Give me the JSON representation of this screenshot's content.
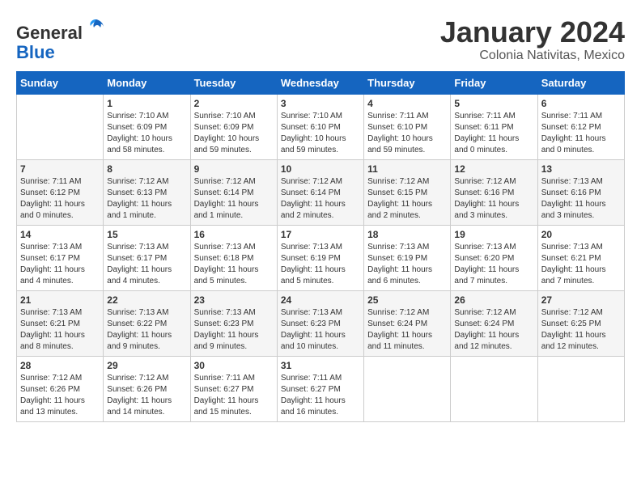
{
  "header": {
    "logo_general": "General",
    "logo_blue": "Blue",
    "month_title": "January 2024",
    "subtitle": "Colonia Nativitas, Mexico"
  },
  "days_of_week": [
    "Sunday",
    "Monday",
    "Tuesday",
    "Wednesday",
    "Thursday",
    "Friday",
    "Saturday"
  ],
  "weeks": [
    [
      {
        "day": "",
        "info": ""
      },
      {
        "day": "1",
        "info": "Sunrise: 7:10 AM\nSunset: 6:09 PM\nDaylight: 10 hours\nand 58 minutes."
      },
      {
        "day": "2",
        "info": "Sunrise: 7:10 AM\nSunset: 6:09 PM\nDaylight: 10 hours\nand 59 minutes."
      },
      {
        "day": "3",
        "info": "Sunrise: 7:10 AM\nSunset: 6:10 PM\nDaylight: 10 hours\nand 59 minutes."
      },
      {
        "day": "4",
        "info": "Sunrise: 7:11 AM\nSunset: 6:10 PM\nDaylight: 10 hours\nand 59 minutes."
      },
      {
        "day": "5",
        "info": "Sunrise: 7:11 AM\nSunset: 6:11 PM\nDaylight: 11 hours\nand 0 minutes."
      },
      {
        "day": "6",
        "info": "Sunrise: 7:11 AM\nSunset: 6:12 PM\nDaylight: 11 hours\nand 0 minutes."
      }
    ],
    [
      {
        "day": "7",
        "info": "Sunrise: 7:11 AM\nSunset: 6:12 PM\nDaylight: 11 hours\nand 0 minutes."
      },
      {
        "day": "8",
        "info": "Sunrise: 7:12 AM\nSunset: 6:13 PM\nDaylight: 11 hours\nand 1 minute."
      },
      {
        "day": "9",
        "info": "Sunrise: 7:12 AM\nSunset: 6:14 PM\nDaylight: 11 hours\nand 1 minute."
      },
      {
        "day": "10",
        "info": "Sunrise: 7:12 AM\nSunset: 6:14 PM\nDaylight: 11 hours\nand 2 minutes."
      },
      {
        "day": "11",
        "info": "Sunrise: 7:12 AM\nSunset: 6:15 PM\nDaylight: 11 hours\nand 2 minutes."
      },
      {
        "day": "12",
        "info": "Sunrise: 7:12 AM\nSunset: 6:16 PM\nDaylight: 11 hours\nand 3 minutes."
      },
      {
        "day": "13",
        "info": "Sunrise: 7:13 AM\nSunset: 6:16 PM\nDaylight: 11 hours\nand 3 minutes."
      }
    ],
    [
      {
        "day": "14",
        "info": "Sunrise: 7:13 AM\nSunset: 6:17 PM\nDaylight: 11 hours\nand 4 minutes."
      },
      {
        "day": "15",
        "info": "Sunrise: 7:13 AM\nSunset: 6:17 PM\nDaylight: 11 hours\nand 4 minutes."
      },
      {
        "day": "16",
        "info": "Sunrise: 7:13 AM\nSunset: 6:18 PM\nDaylight: 11 hours\nand 5 minutes."
      },
      {
        "day": "17",
        "info": "Sunrise: 7:13 AM\nSunset: 6:19 PM\nDaylight: 11 hours\nand 5 minutes."
      },
      {
        "day": "18",
        "info": "Sunrise: 7:13 AM\nSunset: 6:19 PM\nDaylight: 11 hours\nand 6 minutes."
      },
      {
        "day": "19",
        "info": "Sunrise: 7:13 AM\nSunset: 6:20 PM\nDaylight: 11 hours\nand 7 minutes."
      },
      {
        "day": "20",
        "info": "Sunrise: 7:13 AM\nSunset: 6:21 PM\nDaylight: 11 hours\nand 7 minutes."
      }
    ],
    [
      {
        "day": "21",
        "info": "Sunrise: 7:13 AM\nSunset: 6:21 PM\nDaylight: 11 hours\nand 8 minutes."
      },
      {
        "day": "22",
        "info": "Sunrise: 7:13 AM\nSunset: 6:22 PM\nDaylight: 11 hours\nand 9 minutes."
      },
      {
        "day": "23",
        "info": "Sunrise: 7:13 AM\nSunset: 6:23 PM\nDaylight: 11 hours\nand 9 minutes."
      },
      {
        "day": "24",
        "info": "Sunrise: 7:13 AM\nSunset: 6:23 PM\nDaylight: 11 hours\nand 10 minutes."
      },
      {
        "day": "25",
        "info": "Sunrise: 7:12 AM\nSunset: 6:24 PM\nDaylight: 11 hours\nand 11 minutes."
      },
      {
        "day": "26",
        "info": "Sunrise: 7:12 AM\nSunset: 6:24 PM\nDaylight: 11 hours\nand 12 minutes."
      },
      {
        "day": "27",
        "info": "Sunrise: 7:12 AM\nSunset: 6:25 PM\nDaylight: 11 hours\nand 12 minutes."
      }
    ],
    [
      {
        "day": "28",
        "info": "Sunrise: 7:12 AM\nSunset: 6:26 PM\nDaylight: 11 hours\nand 13 minutes."
      },
      {
        "day": "29",
        "info": "Sunrise: 7:12 AM\nSunset: 6:26 PM\nDaylight: 11 hours\nand 14 minutes."
      },
      {
        "day": "30",
        "info": "Sunrise: 7:11 AM\nSunset: 6:27 PM\nDaylight: 11 hours\nand 15 minutes."
      },
      {
        "day": "31",
        "info": "Sunrise: 7:11 AM\nSunset: 6:27 PM\nDaylight: 11 hours\nand 16 minutes."
      },
      {
        "day": "",
        "info": ""
      },
      {
        "day": "",
        "info": ""
      },
      {
        "day": "",
        "info": ""
      }
    ]
  ]
}
